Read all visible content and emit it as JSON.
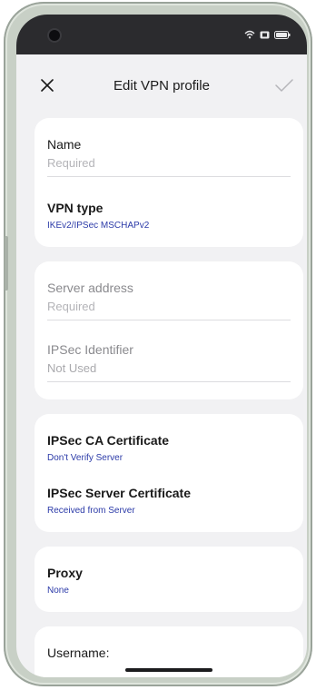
{
  "header": {
    "title": "Edit VPN profile"
  },
  "card_basic": {
    "name_label": "Name",
    "name_placeholder": "Required",
    "vpn_type_label": "VPN type",
    "vpn_type_value": "IKEv2/IPSec MSCHAPv2"
  },
  "card_server": {
    "server_label": "Server address",
    "server_placeholder": "Required",
    "ipsec_id_label": "IPSec Identifier",
    "ipsec_id_value": "Not Used"
  },
  "card_certs": {
    "ca_label": "IPSec CA Certificate",
    "ca_value": "Don't Verify Server",
    "server_cert_label": "IPSec Server Certificate",
    "server_cert_value": "Received from Server"
  },
  "card_proxy": {
    "proxy_label": "Proxy",
    "proxy_value": "None"
  },
  "card_auth": {
    "username_label": "Username:"
  },
  "icons": {
    "close": "close-icon",
    "confirm": "checkmark-icon",
    "wifi": "wifi-icon",
    "battery": "battery-icon"
  },
  "colors": {
    "accent_value": "#2b3aa8",
    "background": "#f1f1f3"
  }
}
